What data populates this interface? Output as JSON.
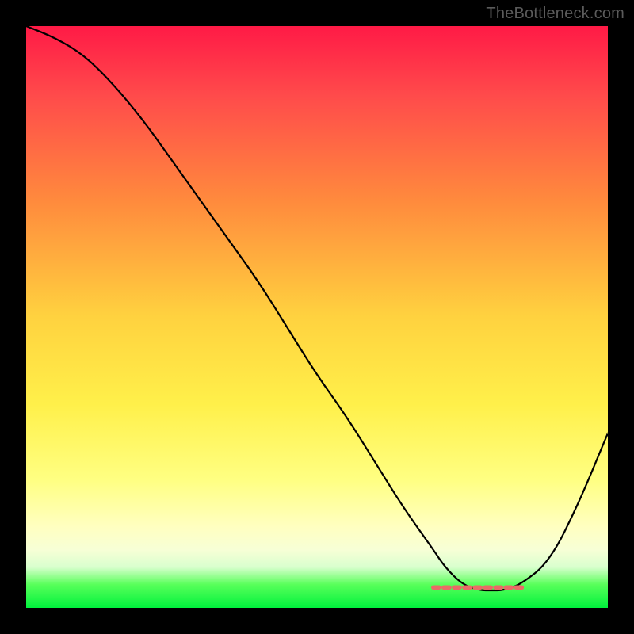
{
  "watermark": "TheBottleneck.com",
  "chart_data": {
    "type": "line",
    "title": "",
    "xlabel": "",
    "ylabel": "",
    "xlim": [
      0,
      100
    ],
    "ylim": [
      0,
      100
    ],
    "series": [
      {
        "name": "bottleneck-curve",
        "x": [
          0,
          5,
          10,
          15,
          20,
          25,
          30,
          35,
          40,
          45,
          50,
          55,
          60,
          65,
          70,
          72,
          75,
          78,
          80,
          82,
          85,
          90,
          95,
          100
        ],
        "values": [
          100,
          98,
          95,
          90,
          84,
          77,
          70,
          63,
          56,
          48,
          40,
          33,
          25,
          17,
          10,
          7,
          4,
          3,
          3,
          3,
          4,
          8,
          18,
          30
        ]
      }
    ],
    "highlight": {
      "name": "green-band-markers",
      "x_start": 70,
      "x_end": 86,
      "y": 3.5
    },
    "gradient_stops": [
      {
        "pos": 0,
        "color": "#ff1a46"
      },
      {
        "pos": 50,
        "color": "#ffd23f"
      },
      {
        "pos": 78,
        "color": "#ffff82"
      },
      {
        "pos": 96,
        "color": "#58ff5a"
      },
      {
        "pos": 100,
        "color": "#00f23d"
      }
    ]
  }
}
